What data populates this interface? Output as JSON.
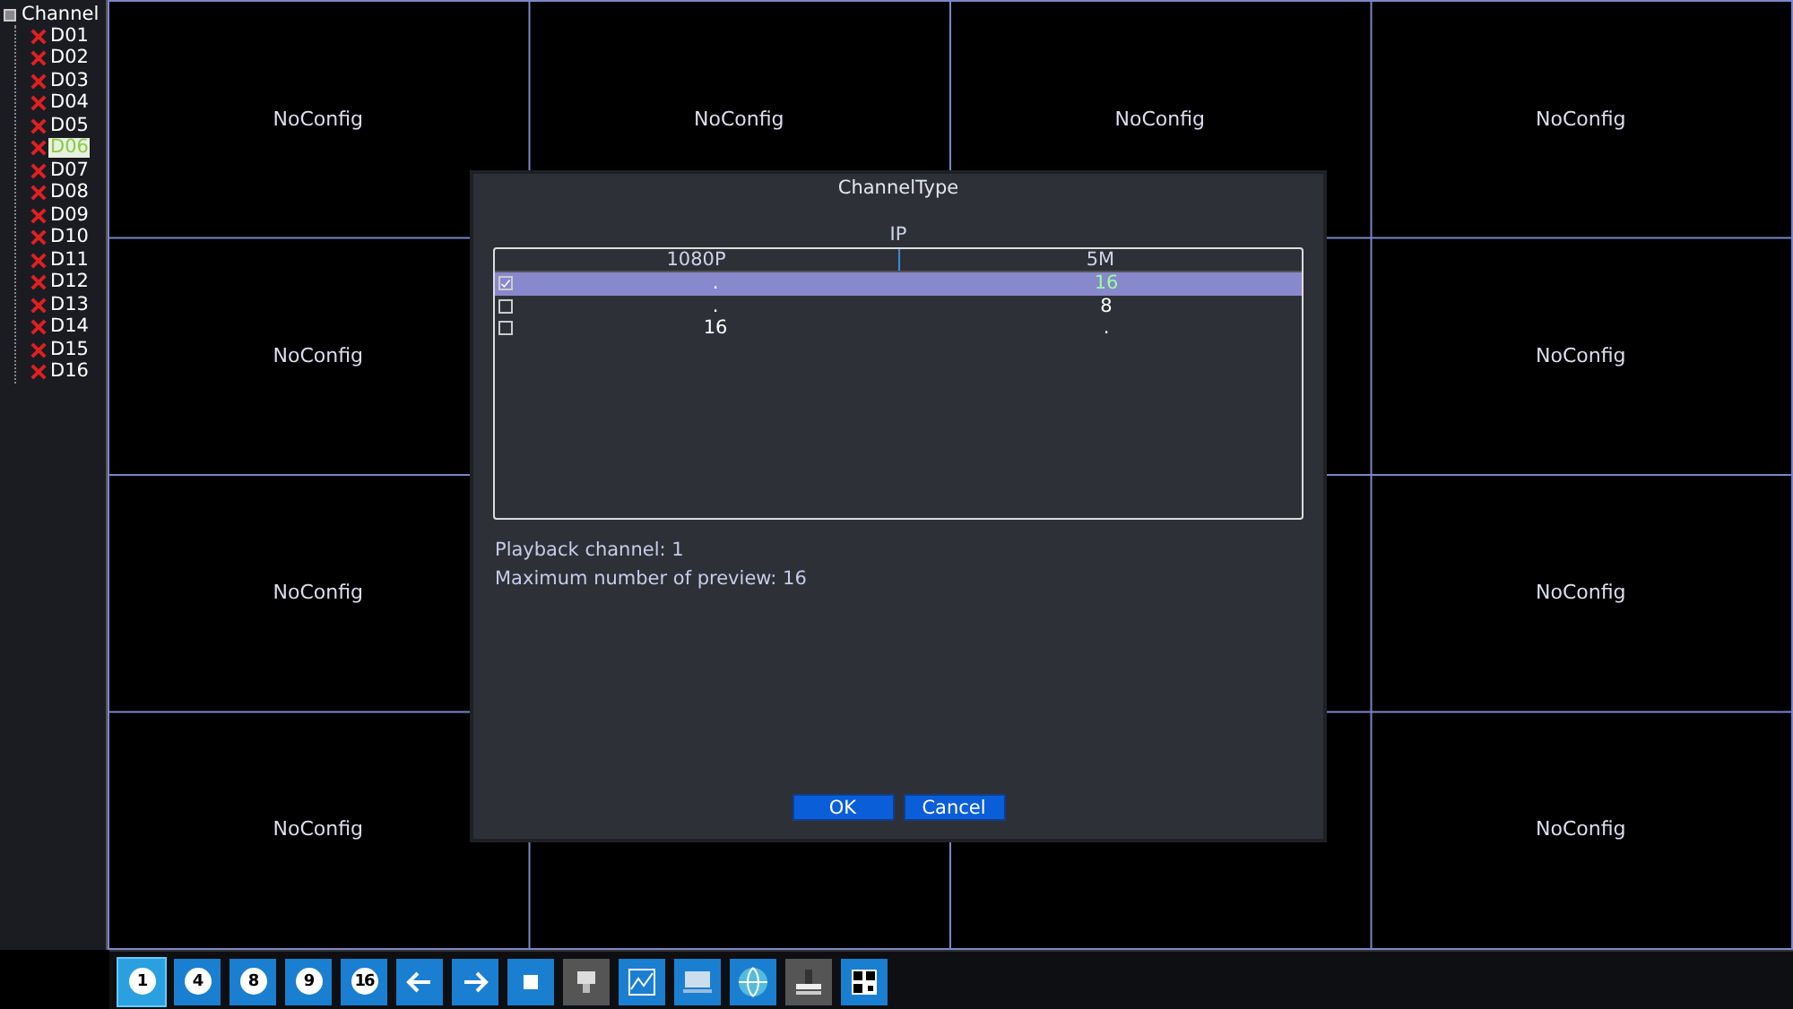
{
  "channel_tree": {
    "label": "Channel",
    "expanded": true,
    "children": [
      {
        "label": "D01",
        "selected": false
      },
      {
        "label": "D02",
        "selected": false
      },
      {
        "label": "D03",
        "selected": false
      },
      {
        "label": "D04",
        "selected": false
      },
      {
        "label": "D05",
        "selected": false
      },
      {
        "label": "D06",
        "selected": true
      },
      {
        "label": "D07",
        "selected": false
      },
      {
        "label": "D08",
        "selected": false
      },
      {
        "label": "D09",
        "selected": false
      },
      {
        "label": "D10",
        "selected": false
      },
      {
        "label": "D11",
        "selected": false
      },
      {
        "label": "D12",
        "selected": false
      },
      {
        "label": "D13",
        "selected": false
      },
      {
        "label": "D14",
        "selected": false
      },
      {
        "label": "D15",
        "selected": false
      },
      {
        "label": "D16",
        "selected": false
      }
    ]
  },
  "video_grid": [
    {
      "tiles": [
        "NoConfig",
        "NoConfig",
        "NoConfig",
        "NoConfig"
      ]
    },
    {
      "tiles": [
        "NoConfig",
        "NoConfig"
      ]
    },
    {
      "tiles": [
        "NoConfig",
        "NoConfig"
      ]
    },
    {
      "tiles": [
        "NoConfig",
        "NoConfig"
      ]
    }
  ],
  "dialog": {
    "title": "ChannelType",
    "group_label": "IP",
    "table": {
      "columns": [
        "1080P",
        "5M"
      ],
      "rows": [
        {
          "selected": true,
          "checked": true,
          "cells": [
            ".",
            "16"
          ]
        },
        {
          "selected": false,
          "checked": false,
          "cells": [
            ".",
            "8"
          ]
        },
        {
          "selected": false,
          "checked": false,
          "cells": [
            "16",
            "."
          ]
        }
      ]
    },
    "info": [
      "Playback channel: 1",
      "Maximum number of preview: 16"
    ],
    "buttons": [
      "OK",
      "Cancel"
    ]
  },
  "toolbar": [
    {
      "kind": "layout",
      "label": "1",
      "selected": true
    },
    {
      "kind": "layout",
      "label": "4",
      "selected": false
    },
    {
      "kind": "layout",
      "label": "8",
      "selected": false
    },
    {
      "kind": "layout",
      "label": "9",
      "selected": false
    },
    {
      "kind": "layout",
      "label": "16",
      "selected": false
    },
    {
      "kind": "left",
      "selected": false
    },
    {
      "kind": "right",
      "selected": false
    },
    {
      "kind": "square",
      "selected": false
    },
    {
      "kind": "camera",
      "selected": false
    },
    {
      "kind": "chart",
      "selected": false
    },
    {
      "kind": "monitor",
      "selected": false
    },
    {
      "kind": "globe",
      "selected": false
    },
    {
      "kind": "stamp",
      "selected": false
    },
    {
      "kind": "qr",
      "selected": false
    }
  ]
}
